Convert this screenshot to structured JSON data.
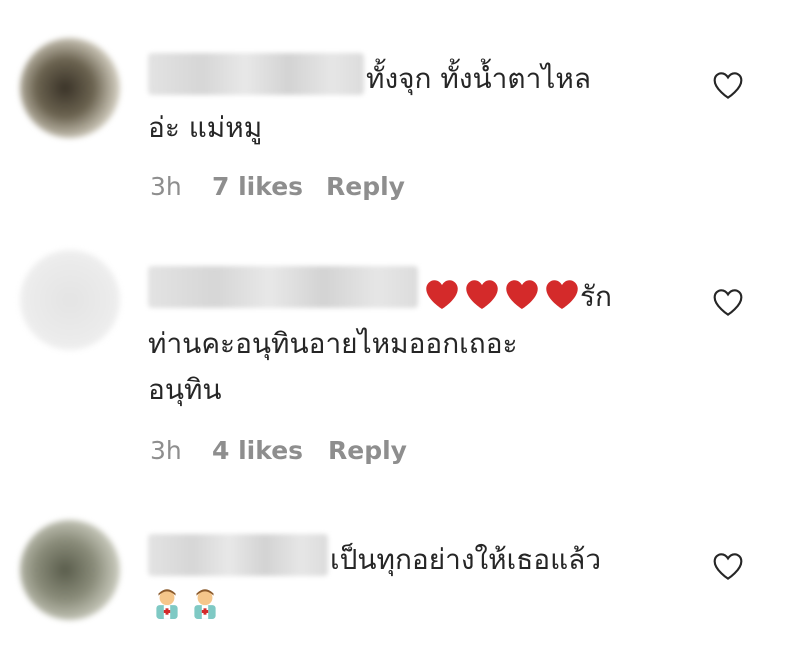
{
  "comments": [
    {
      "text_line1": "ทั้งจุก ทั้งน้ำตาไหล",
      "text_line2": "อ่ะ แม่หมู",
      "time": "3h",
      "likes": "7 likes",
      "reply": "Reply",
      "like_icon": "heart-outline-icon",
      "username_blurred": true
    },
    {
      "text_line1_suffix": "รัก",
      "text_line2": "ท่านคะอนุทินอายไหมออกเถอะ",
      "text_line3": "อนุทิน",
      "hearts_count": 4,
      "heart_emoji_color": "#d42a2a",
      "time": "3h",
      "likes": "4 likes",
      "reply": "Reply",
      "like_icon": "heart-outline-icon",
      "username_blurred": true
    },
    {
      "text_line1": "เป็นทุกอย่างให้เธอแล้ว",
      "emoji_icon": "health-worker-emoji-icon",
      "emoji_count": 2,
      "like_icon": "heart-outline-icon",
      "username_blurred": true
    }
  ],
  "colors": {
    "text": "#262626",
    "meta": "#8e8e8e"
  }
}
